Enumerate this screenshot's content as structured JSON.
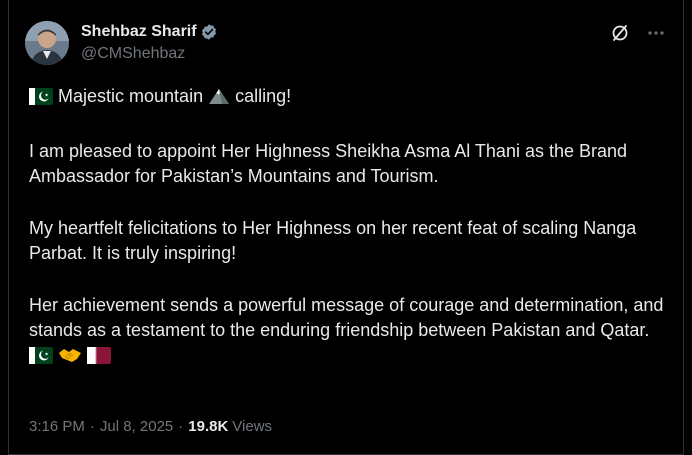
{
  "author": {
    "display_name": "Shehbaz Sharif",
    "handle": "@CMShehbaz",
    "verified_icon": "verified-badge-icon"
  },
  "actions": {
    "grok_icon": "grok-icon",
    "more_icon": "more-icon"
  },
  "tweet": {
    "line1_text": "Majestic mountain",
    "line1_suffix": "calling!",
    "para2": "I am pleased to appoint Her Highness Sheikha Asma Al Thani as the Brand Ambassador for Pakistan’s Mountains and Tourism.",
    "para3": "My heartfelt felicitations to Her Highness on her recent feat of scaling Nanga Parbat. It is truly inspiring!",
    "para4": "Her achievement sends a powerful message of courage and determination, and stands as a testament to the enduring friendship between Pakistan and Qatar."
  },
  "meta": {
    "time": "3:16 PM",
    "date": "Jul 8, 2025",
    "separator": "·",
    "views_count": "19.8K",
    "views_label": "Views"
  },
  "colors": {
    "background": "#000000",
    "text": "#e7e9ea",
    "muted": "#71767b",
    "verified": "#829aab",
    "border": "#2f3336"
  }
}
